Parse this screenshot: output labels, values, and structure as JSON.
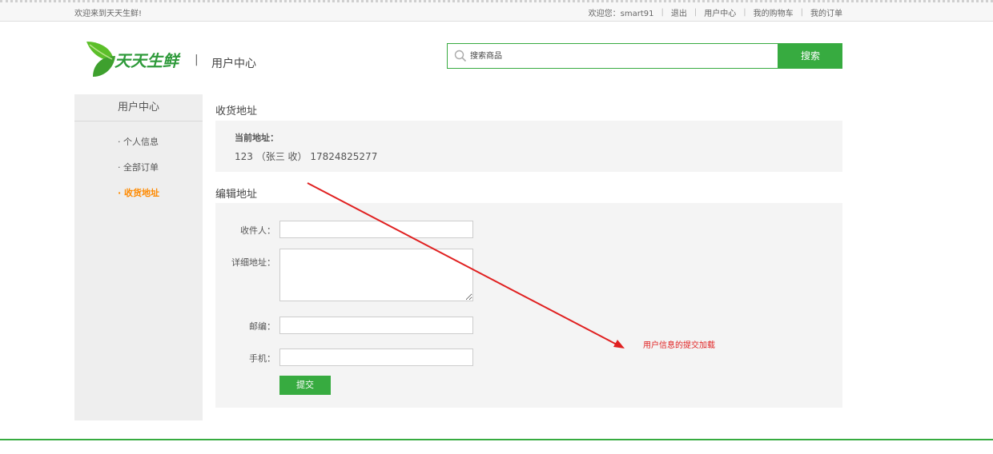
{
  "topbar": {
    "welcome": "欢迎来到天天生鲜!",
    "greeting": "欢迎您：smart91",
    "links": [
      "退出",
      "用户中心",
      "我的购物车",
      "我的订单"
    ]
  },
  "header": {
    "logo_text": "天天生鲜",
    "separator": "|",
    "title": "用户中心"
  },
  "search": {
    "placeholder": "搜索商品",
    "button": "搜索"
  },
  "sidebar": {
    "heading": "用户中心",
    "items": [
      {
        "label": "· 个人信息",
        "active": false
      },
      {
        "label": "· 全部订单",
        "active": false
      },
      {
        "label": "· 收货地址",
        "active": true
      }
    ]
  },
  "current_address": {
    "section_title": "收货地址",
    "label": "当前地址：",
    "value": "123 （张三 收） 17824825277"
  },
  "edit_address": {
    "section_title": "编辑地址",
    "fields": {
      "receiver": {
        "label": "收件人：",
        "value": ""
      },
      "detail": {
        "label": "详细地址：",
        "value": ""
      },
      "postcode": {
        "label": "邮编：",
        "value": ""
      },
      "phone": {
        "label": "手机：",
        "value": ""
      }
    },
    "submit": "提交"
  },
  "annotation": {
    "text": "用户信息的提交加载"
  },
  "colors": {
    "brand_green": "#37ab40",
    "active_orange": "#ff8a00",
    "annotation_red": "#e02020"
  },
  "icons": [
    "leaf-logo-icon",
    "search-icon"
  ]
}
